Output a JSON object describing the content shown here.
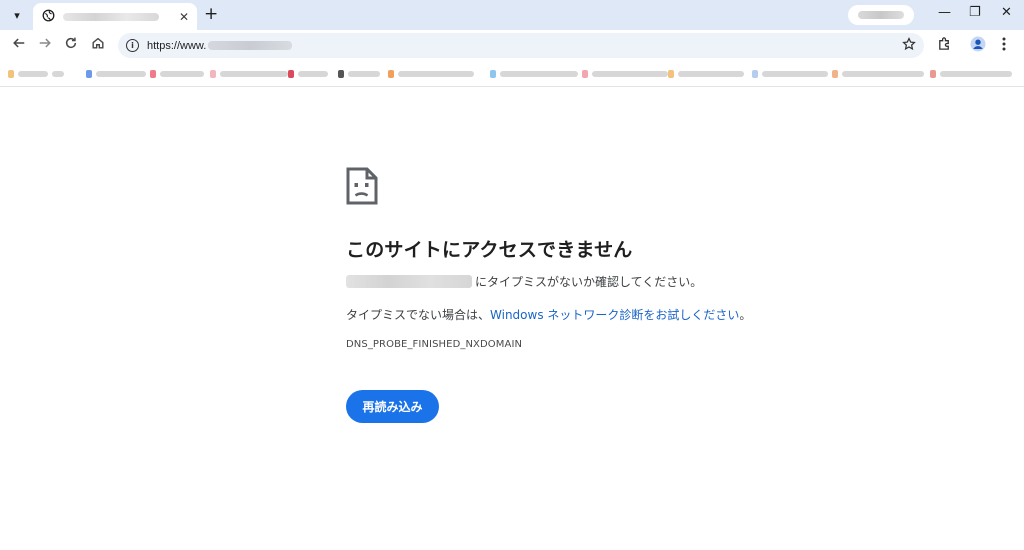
{
  "browser": {
    "tab_close_glyph": "✕",
    "new_tab_glyph": "+",
    "window_controls": {
      "minimize": "—",
      "restore": "❐",
      "close": "✕"
    },
    "address_bar": {
      "url_prefix": "https://www."
    }
  },
  "error_page": {
    "title": "このサイトにアクセスできません",
    "typo_message": "にタイプミスがないか確認してください。",
    "suggestion_prefix": "タイプミスでない場合は、",
    "diagnostics_link": "Windows ネットワーク診断をお試しください",
    "suggestion_suffix": "。",
    "error_code": "DNS_PROBE_FINISHED_NXDOMAIN",
    "reload_button": "再読み込み"
  },
  "colors": {
    "tabstrip_bg": "#dfe8f7",
    "omnibox_bg": "#eef2f9",
    "link": "#1a64c8",
    "button_bg": "#1a73e8"
  }
}
